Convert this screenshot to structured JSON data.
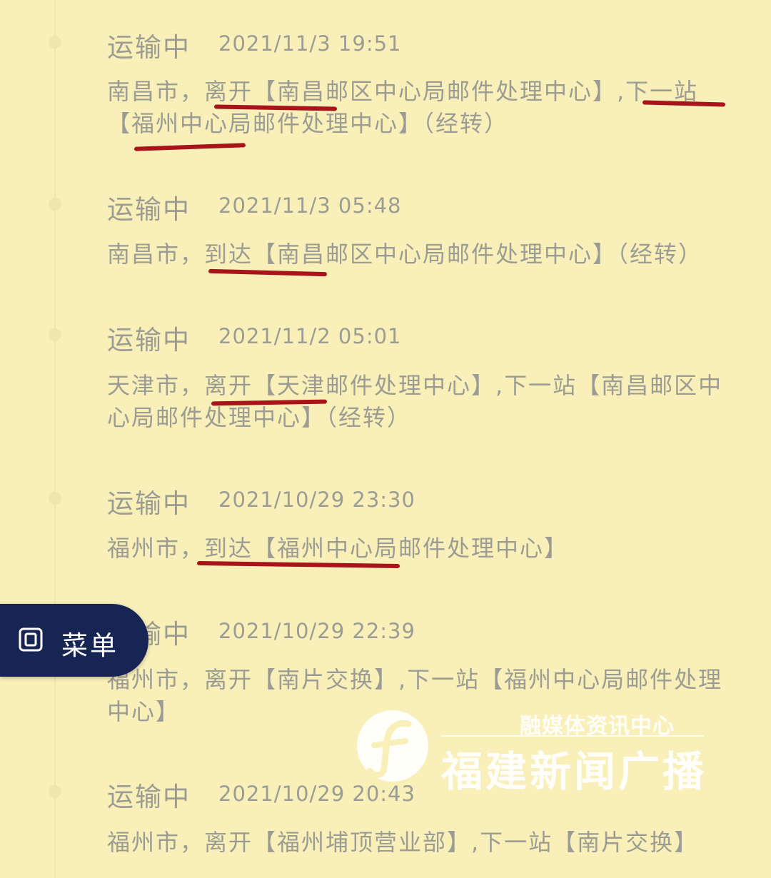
{
  "entries": [
    {
      "status": "运输中",
      "time": "2021/11/3 19:51",
      "desc": "南昌市，离开【南昌邮区中心局邮件处理中心】,下一站【福州中心局邮件处理中心】（经转）"
    },
    {
      "status": "运输中",
      "time": "2021/11/3 05:48",
      "desc": "南昌市，到达【南昌邮区中心局邮件处理中心】（经转）"
    },
    {
      "status": "运输中",
      "time": "2021/11/2 05:01",
      "desc": "天津市，离开【天津邮件处理中心】,下一站【南昌邮区中心局邮件处理中心】（经转）"
    },
    {
      "status": "运输中",
      "time": "2021/10/29 23:30",
      "desc": "福州市，到达【福州中心局邮件处理中心】"
    },
    {
      "status": "运输中",
      "time": "2021/10/29 22:39",
      "desc": "福州市，离开【南片交换】,下一站【福州中心局邮件处理中心】"
    },
    {
      "status": "运输中",
      "time": "2021/10/29 20:43",
      "desc": "福州市，离开【福州埔顶营业部】,下一站【南片交换】"
    }
  ],
  "menu": {
    "label": "菜单",
    "icon": "menu-square-icon"
  },
  "watermark": {
    "top_text": "融媒体资讯中心",
    "main_text": "福建新闻广播",
    "logo": "fujian-news-logo-icon"
  },
  "colors": {
    "background": "#f8f0b8",
    "text": "#9c9c94",
    "underline": "#a8141a",
    "menu_bg": "#172554"
  }
}
